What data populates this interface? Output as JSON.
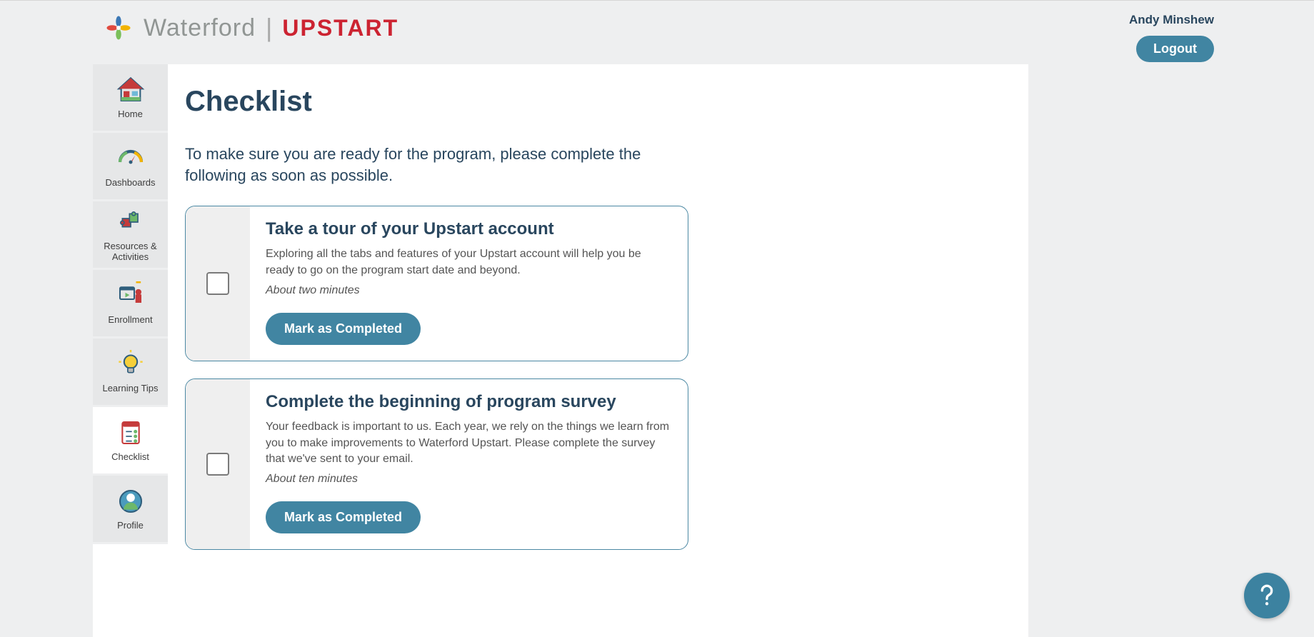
{
  "header": {
    "brand_waterford": "Waterford",
    "brand_upstart": "UPSTART",
    "user_name": "Andy Minshew",
    "logout_label": "Logout"
  },
  "sidebar": {
    "items": [
      {
        "id": "home",
        "label": "Home",
        "active": false
      },
      {
        "id": "dashboards",
        "label": "Dashboards",
        "active": false
      },
      {
        "id": "resources",
        "label": "Resources & Activities",
        "active": false
      },
      {
        "id": "enrollment",
        "label": "Enrollment",
        "active": false
      },
      {
        "id": "learning-tips",
        "label": "Learning Tips",
        "active": false
      },
      {
        "id": "checklist",
        "label": "Checklist",
        "active": true
      },
      {
        "id": "profile",
        "label": "Profile",
        "active": false
      }
    ]
  },
  "page": {
    "title": "Checklist",
    "intro": "To make sure you are ready for the program, please complete the following as soon as possible."
  },
  "checklist": [
    {
      "title": "Take a tour of your Upstart account",
      "description": "Exploring all the tabs and features of your Upstart account will help you be ready to go on the program start date and beyond.",
      "duration": "About two minutes",
      "button": "Mark as Completed"
    },
    {
      "title": "Complete the beginning of program survey",
      "description": "Your feedback is important to us. Each year, we rely on the things we learn from you to make improvements to Waterford Upstart. Please complete the survey that we've sent to your email.",
      "duration": "About ten minutes",
      "button": "Mark as Completed"
    }
  ]
}
